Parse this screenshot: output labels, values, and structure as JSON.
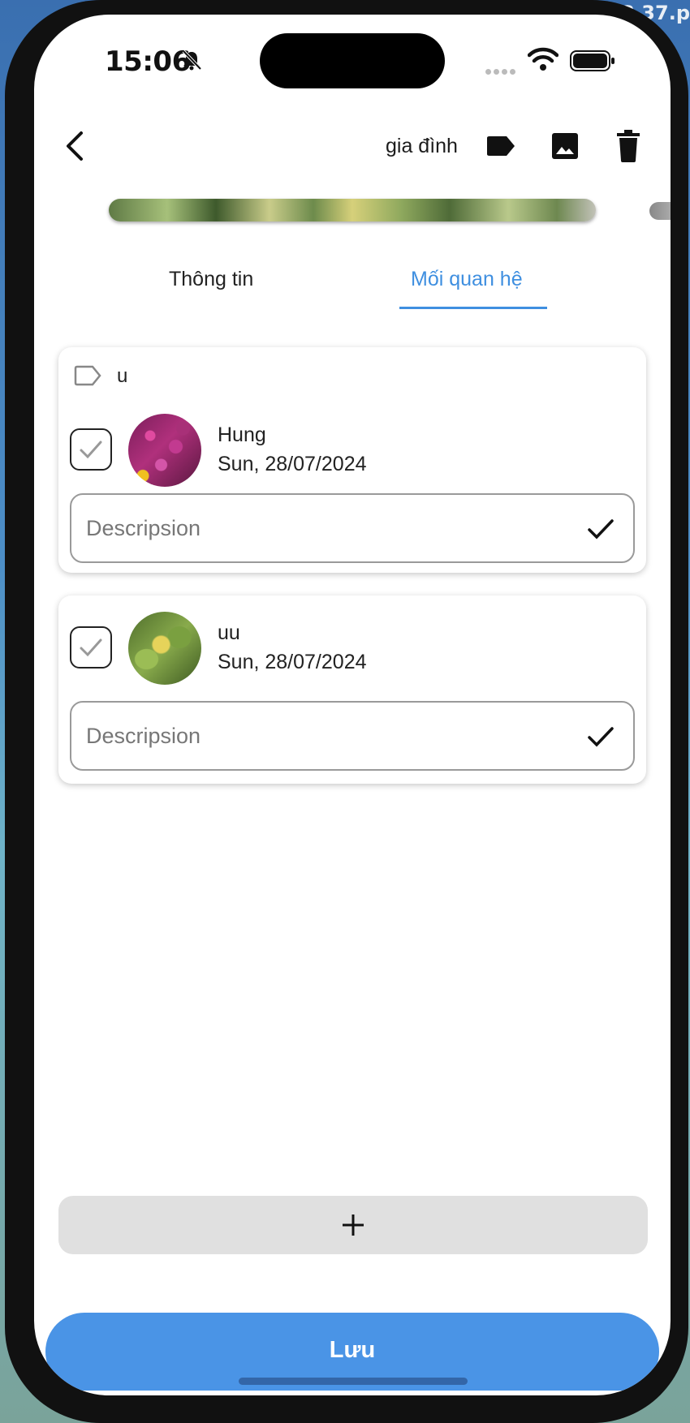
{
  "window": {
    "corner_text": "3 37.p"
  },
  "status_bar": {
    "time": "15:06"
  },
  "header": {
    "category": "gia đình"
  },
  "tabs": [
    {
      "label": "Thông tin",
      "active": false
    },
    {
      "label": "Mối quan hệ",
      "active": true
    }
  ],
  "accent_color": "#3f8fe0",
  "relationships": [
    {
      "group": "u",
      "name": "Hung",
      "date": "Sun, 28/07/2024",
      "description_placeholder": "Descripsion",
      "avatar": "flowers-photo"
    },
    {
      "group": "",
      "name": "uu",
      "date": "Sun, 28/07/2024",
      "description_placeholder": "Descripsion",
      "avatar": "leaves-photo"
    }
  ],
  "add_button": {
    "icon": "plus-icon"
  },
  "save_button": {
    "label": "Lưu",
    "color": "#4a94e6"
  }
}
